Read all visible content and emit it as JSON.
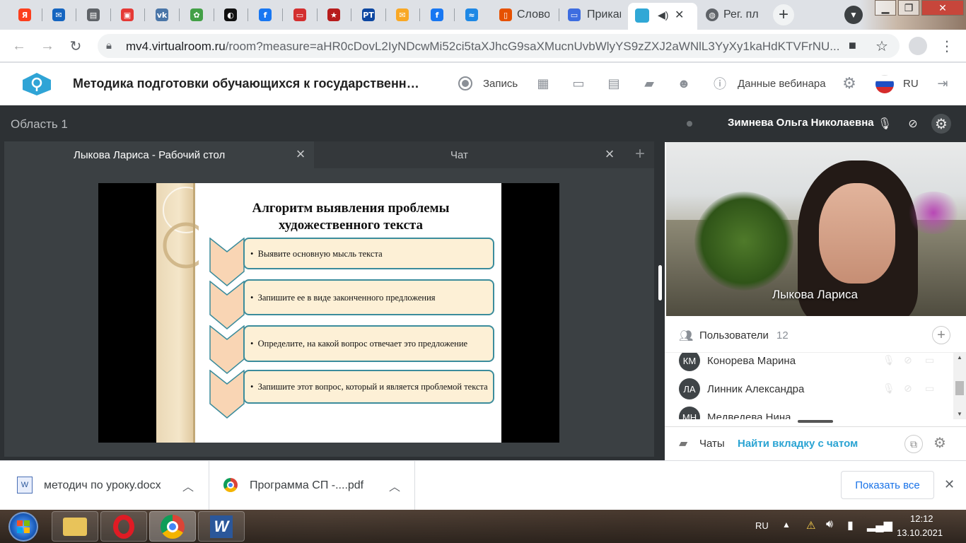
{
  "browser": {
    "tabs": [
      {
        "icon": "yandex-icon",
        "glyph": "Я",
        "color": "#fc3f1d"
      },
      {
        "icon": "mail-icon",
        "glyph": "✉",
        "color": "#1565c0"
      },
      {
        "icon": "document-icon",
        "glyph": "▤",
        "color": "#5f6368"
      },
      {
        "icon": "photo-icon",
        "glyph": "▣",
        "color": "#e53935"
      },
      {
        "icon": "vk-icon",
        "glyph": "vk",
        "color": "#4a76a8"
      },
      {
        "icon": "flower-icon",
        "glyph": "✿",
        "color": "#43a047"
      },
      {
        "icon": "app-icon",
        "glyph": "◐",
        "color": "#111111"
      },
      {
        "icon": "facebook-icon",
        "glyph": "f",
        "color": "#1877f2"
      },
      {
        "icon": "red-doc-icon",
        "glyph": "▭",
        "color": "#d32f2f"
      },
      {
        "icon": "star-icon",
        "glyph": "★",
        "color": "#b71c1c"
      },
      {
        "icon": "rt-icon",
        "glyph": "РТ",
        "color": "#0d47a1"
      },
      {
        "icon": "mail-envelope-icon",
        "glyph": "✉",
        "color": "#f9a825"
      },
      {
        "icon": "facebook-icon",
        "glyph": "f",
        "color": "#1877f2"
      },
      {
        "icon": "wave-icon",
        "glyph": "≈",
        "color": "#1e88e5"
      }
    ],
    "tab_slovo": "Слово",
    "tab_prikaz": "Прикаг",
    "tab_reg": "Рег. пл",
    "url_domain": "mv4.virtualroom.ru",
    "url_rest": "/room?measure=aHR0cDovL2IyNDcwMi52ci5taXJhcG9saXMucnUvbWlyYS9zZXJ2aWNlL3YyXy1kaHdKTVFrNU..."
  },
  "header": {
    "title": "Методика подготовки обучающихся к государственной и...",
    "record_label": "Запись",
    "webinar_data_label": "Данные вебинара",
    "lang": "RU"
  },
  "workspace": {
    "area_title": "Область 1",
    "tab_desktop": "Лыкова Лариса - Рабочий стол",
    "tab_chat": "Чат"
  },
  "slide": {
    "title": "Алгоритм выявления проблемы художественного текста",
    "steps": [
      "Выявите основную мысль текста",
      "Запишите ее в виде законченного предложения",
      "Определите, на какой вопрос отвечает это предложение",
      "Запишите этот вопрос, который и является проблемой текста"
    ]
  },
  "sidebar": {
    "speaker_name": "Зимнева Ольга Николаевна",
    "video_name": "Лыкова Лариса",
    "users_label": "Пользователи",
    "users_count": "12",
    "users": [
      {
        "initials": "КМ",
        "name": "Конорева Марина"
      },
      {
        "initials": "ЛА",
        "name": "Линник Александра"
      },
      {
        "initials": "МН",
        "name": "Медведева Нина"
      }
    ],
    "chats_label": "Чаты",
    "find_chat_label": "Найти вкладку с чатом"
  },
  "downloads": {
    "items": [
      "методич по уроку.docx",
      "Программа СП -....pdf"
    ],
    "show_all": "Показать все"
  },
  "taskbar": {
    "lang": "RU",
    "time": "12:12",
    "date": "13.10.2021"
  }
}
